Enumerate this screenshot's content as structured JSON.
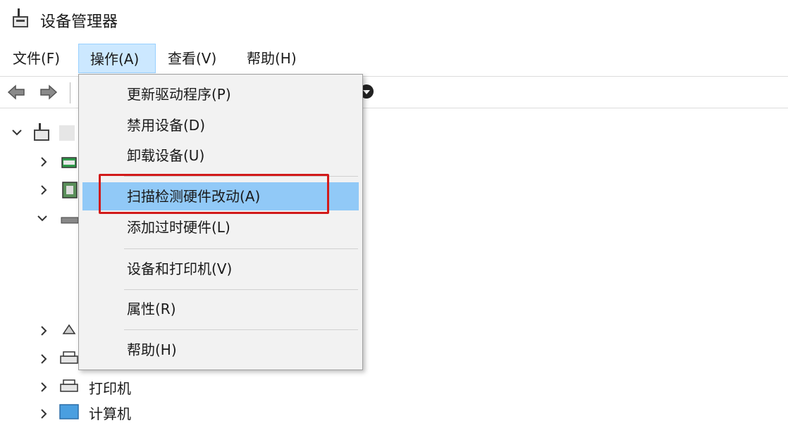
{
  "window": {
    "title": "设备管理器",
    "icon": "device-manager-icon"
  },
  "menubar": {
    "items": [
      {
        "label": "文件(F)"
      },
      {
        "label": "操作(A)"
      },
      {
        "label": "查看(V)"
      },
      {
        "label": "帮助(H)"
      }
    ],
    "active": "操作(A)"
  },
  "toolbar": {
    "buttons": [
      "back-arrow-icon",
      "forward-arrow-icon",
      "update-driver-icon"
    ]
  },
  "action_menu": {
    "items": [
      {
        "label": "更新驱动程序(P)"
      },
      {
        "label": "禁用设备(D)"
      },
      {
        "label": "卸载设备(U)"
      },
      {
        "label": "扫描检测硬件改动(A)"
      },
      {
        "label": "添加过时硬件(L)"
      },
      {
        "label": "设备和打印机(V)"
      },
      {
        "label": "属性(R)"
      },
      {
        "label": "帮助(H)"
      }
    ],
    "highlighted": "扫描检测硬件改动(A)",
    "accent_color": "#91c9f7",
    "annotation_color": "#d21a1a"
  },
  "tree": {
    "visible_labels": [
      {
        "label": "打印机"
      },
      {
        "label": "计算机"
      }
    ]
  }
}
